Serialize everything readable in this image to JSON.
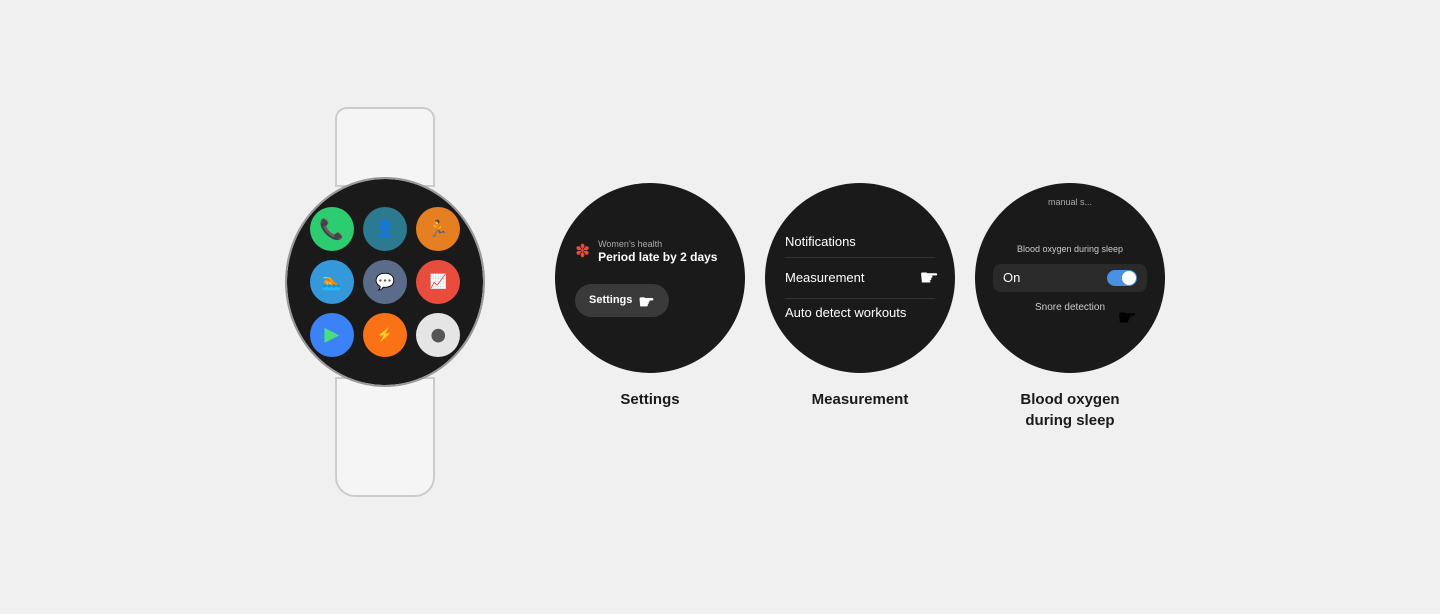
{
  "page": {
    "background": "#f0f0f0"
  },
  "watch": {
    "screen_bg": "#1a1a1a",
    "apps": [
      {
        "name": "Phone",
        "color": "#2ecc71",
        "icon": "📞"
      },
      {
        "name": "Contacts",
        "color": "#2c7a8f",
        "icon": "👤"
      },
      {
        "name": "Person",
        "color": "#e67e22",
        "icon": "🏃"
      },
      {
        "name": "Activity",
        "color": "#3498db",
        "icon": "🏊"
      },
      {
        "name": "Messages",
        "color": "#5b6b8a",
        "icon": "💬"
      },
      {
        "name": "Pulse",
        "color": "#e74c3c",
        "icon": "📈"
      },
      {
        "name": "Play Store",
        "color": "#3b82f6",
        "icon": "▶"
      },
      {
        "name": "App1",
        "color": "#f97316",
        "icon": "🔥"
      },
      {
        "name": "Galaxy",
        "color": "#e5e5e5",
        "icon": "⬤"
      }
    ]
  },
  "screen1": {
    "notification_subtitle": "Women's health",
    "notification_title": "Period late by 2 days",
    "button_label": "Settings",
    "label": "Settings"
  },
  "screen2": {
    "menu_items": [
      "Notifications",
      "Measurement",
      "Auto detect workouts"
    ],
    "label": "Measurement"
  },
  "screen3": {
    "partial_top": "manual s...",
    "header": "Blood oxygen during sleep",
    "toggle_label": "On",
    "snore_label": "Snore detection",
    "label": "Blood oxygen\nduring sleep"
  }
}
